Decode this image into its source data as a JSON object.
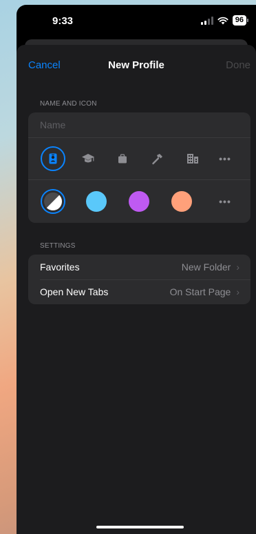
{
  "status_bar": {
    "time": "9:33",
    "battery_level": "96",
    "icons": [
      "signal-icon",
      "wifi-icon",
      "battery-icon"
    ]
  },
  "nav": {
    "cancel_label": "Cancel",
    "title": "New Profile",
    "done_label": "Done"
  },
  "name_and_icon": {
    "header": "NAME AND ICON",
    "name_placeholder": "Name",
    "name_value": "",
    "icons": [
      "person-badge-icon",
      "graduation-cap-icon",
      "briefcase-icon",
      "hammer-icon",
      "building-icon",
      "more-icon"
    ],
    "selected_icon": "person-badge-icon",
    "colors": [
      {
        "name": "default-color",
        "value": "#4a4a4c"
      },
      {
        "name": "blue-color",
        "value": "#5ac8fa"
      },
      {
        "name": "purple-color",
        "value": "#bf5af2"
      },
      {
        "name": "orange-color",
        "value": "#ffa07a"
      }
    ],
    "selected_color": "default-color",
    "more_label": "•••"
  },
  "settings": {
    "header": "SETTINGS",
    "rows": [
      {
        "label": "Favorites",
        "value": "New Folder"
      },
      {
        "label": "Open New Tabs",
        "value": "On Start Page"
      }
    ]
  },
  "colors": {
    "accent": "#0a84ff",
    "background": "#1c1c1e",
    "card": "#2c2c2e"
  }
}
